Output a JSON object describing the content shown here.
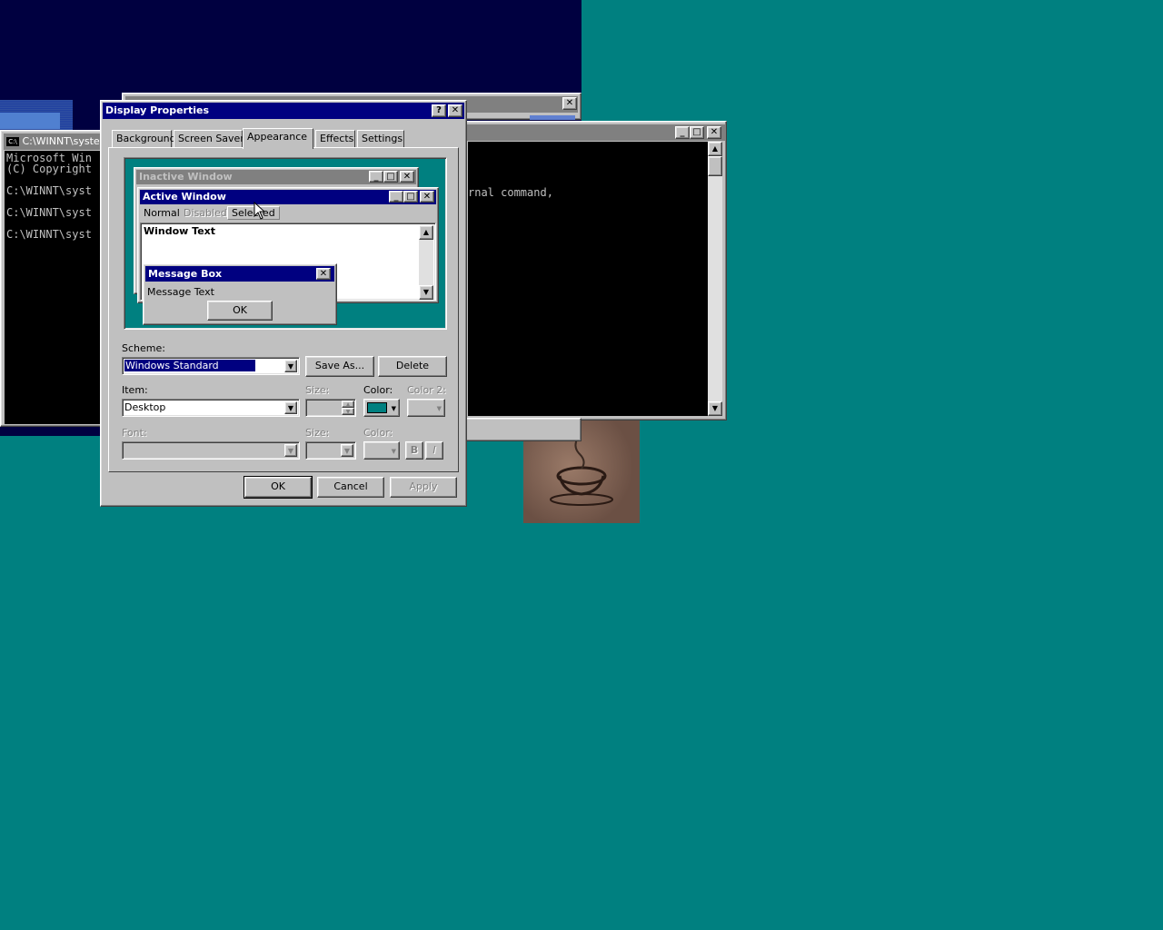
{
  "desktop": {
    "background_color": "#008080",
    "accent_titlebar": "#000080"
  },
  "cmd_left": {
    "title": "C:\\WINNT\\syste",
    "lines": [
      "Microsoft Win",
      "(C) Copyright",
      "",
      "C:\\WINNT\\syst",
      "",
      "C:\\WINNT\\syst",
      "",
      "C:\\WINNT\\syst"
    ]
  },
  "cmd_right": {
    "text_line": "rnal command,"
  },
  "dialog": {
    "title": "Display Properties",
    "help_label": "?",
    "close_label": "✕",
    "tabs": [
      "Background",
      "Screen Saver",
      "Appearance",
      "Effects",
      "Settings"
    ],
    "active_tab": "Appearance",
    "preview": {
      "inactive_title": "Inactive Window",
      "active_title": "Active Window",
      "menu_items": [
        "Normal",
        "Disabled",
        "Selected"
      ],
      "window_text": "Window Text",
      "msgbox_title": "Message Box",
      "msgbox_text": "Message Text",
      "msgbox_ok": "OK"
    },
    "scheme": {
      "label": "Scheme:",
      "value": "Windows Standard",
      "save_as": "Save As...",
      "delete": "Delete"
    },
    "item": {
      "label": "Item:",
      "value": "Desktop",
      "size_label": "Size:",
      "color_label": "Color:",
      "color2_label": "Color 2:",
      "color_value": "#008080"
    },
    "font": {
      "label": "Font:",
      "size_label": "Size:",
      "color_label": "Color:",
      "bold_label": "B",
      "italic_label": "I"
    },
    "buttons": {
      "ok": "OK",
      "cancel": "Cancel",
      "apply": "Apply"
    }
  }
}
